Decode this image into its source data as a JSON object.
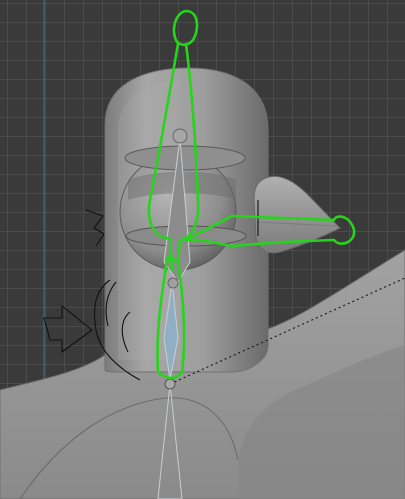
{
  "viewport": {
    "background_color": "#3a3a3a",
    "grid_color": "#505050",
    "axis_line_color": "#3d6a94",
    "mesh_color": "#9a9a9a",
    "mesh_shadow_color": "#5c5c5c",
    "bone_color": "#c9cdd0",
    "bone_selected_color": "#8fb0c4",
    "control_outline_color": "#26d41c",
    "grease_pencil_color": "#111111",
    "relationship_line_color": "#151515"
  },
  "objects": [
    {
      "name": "character-body-mesh",
      "type": "mesh"
    },
    {
      "name": "beak-mesh",
      "type": "mesh"
    },
    {
      "name": "eye-sphere-mesh",
      "type": "mesh"
    },
    {
      "name": "armature",
      "type": "armature"
    },
    {
      "name": "head-control-shape",
      "type": "custom-bone-shape"
    },
    {
      "name": "beak-control-shape",
      "type": "custom-bone-shape"
    },
    {
      "name": "annotation-strokes",
      "type": "grease-pencil"
    }
  ]
}
